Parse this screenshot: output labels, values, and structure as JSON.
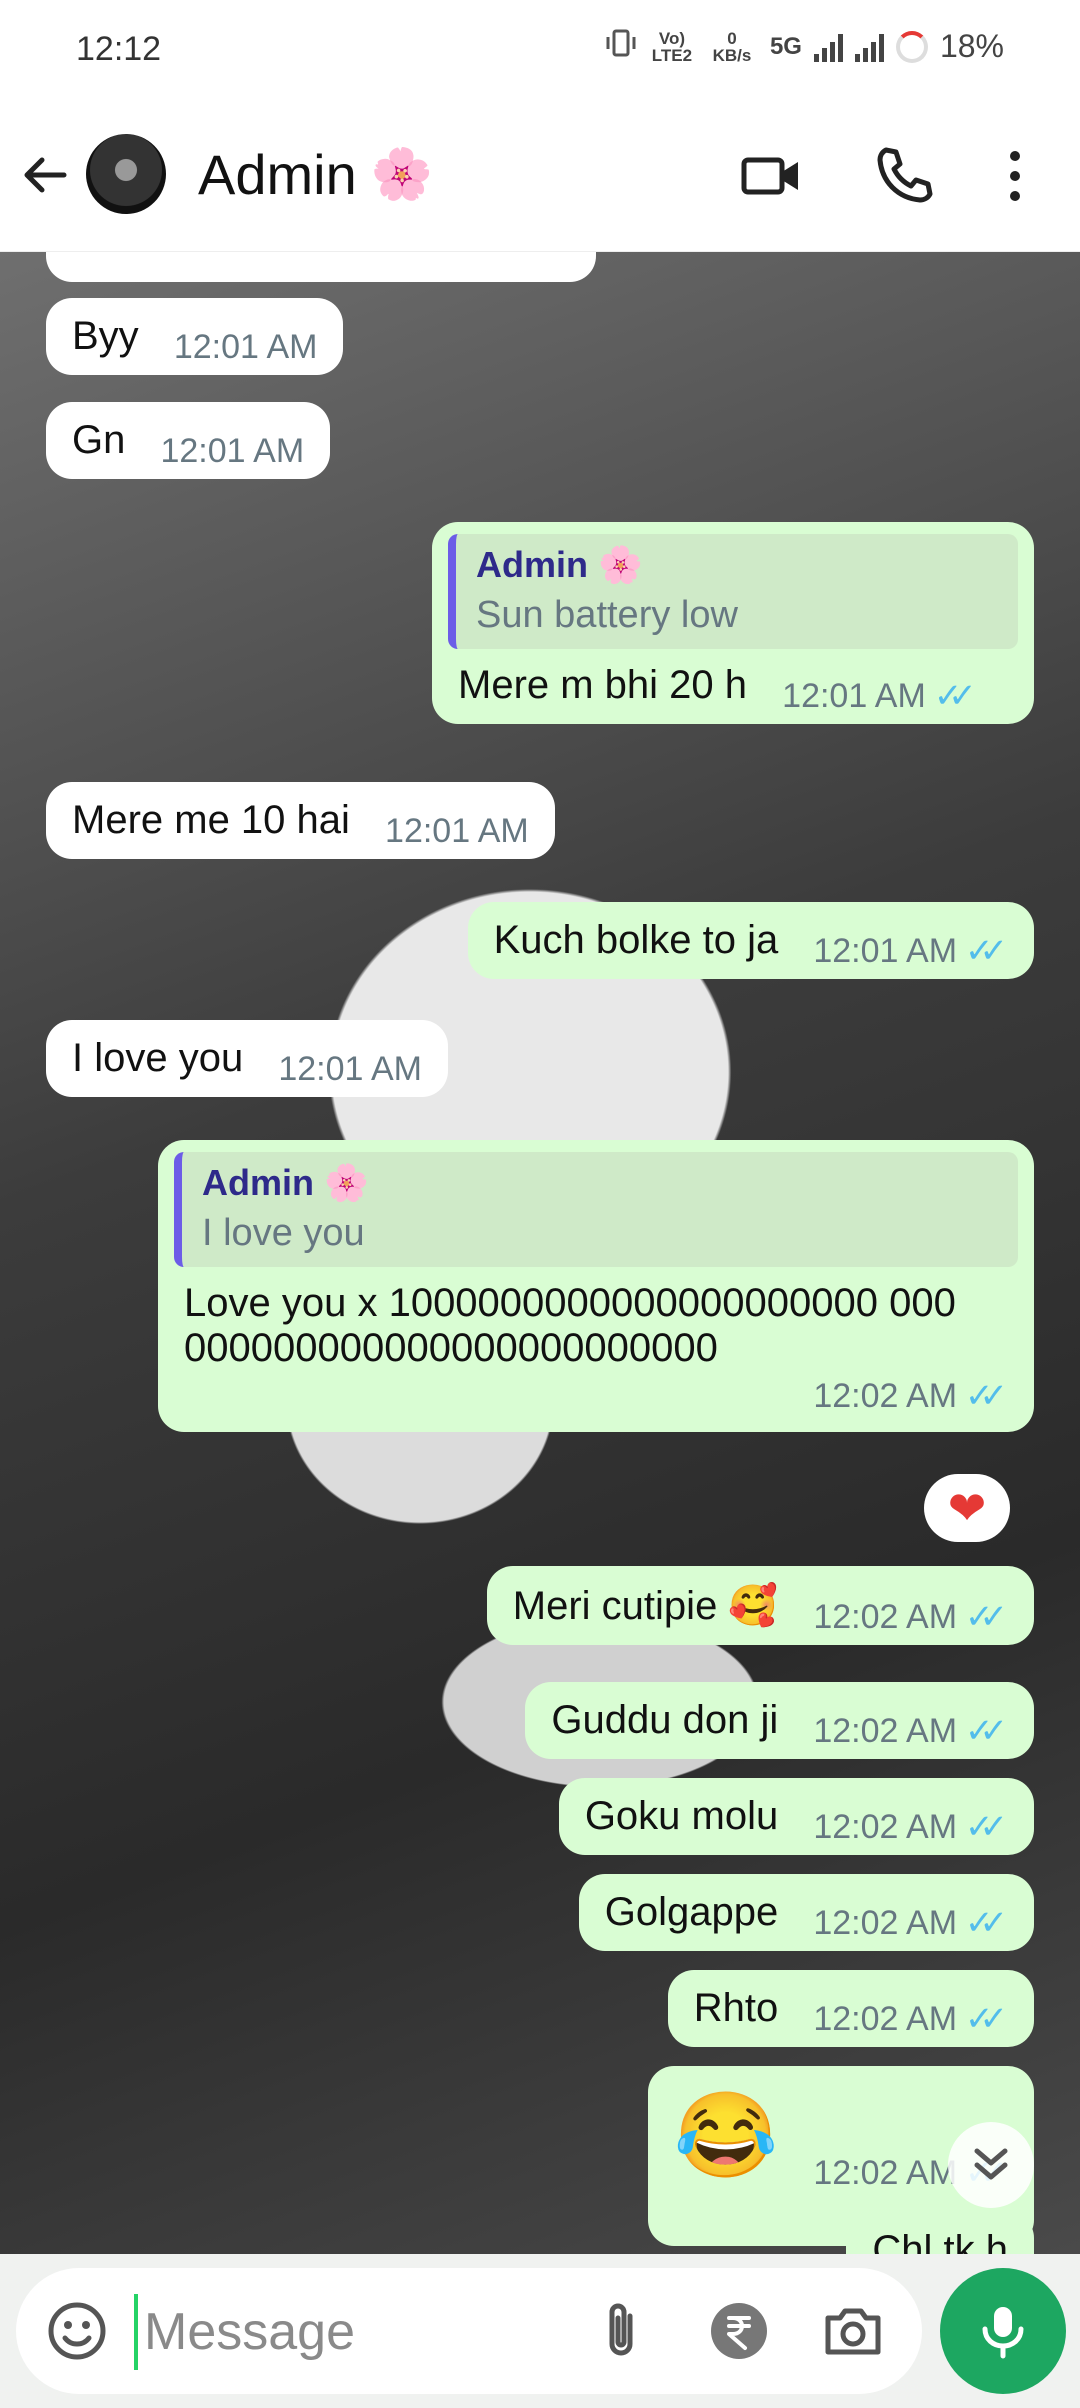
{
  "status_bar": {
    "time": "12:12",
    "volte": "Vo) LTE2",
    "network_speed": "0 KB/s",
    "network": "5G",
    "battery": "18%"
  },
  "app_bar": {
    "title": "Admin",
    "title_emoji": "🌸",
    "icons": [
      "back-arrow-icon",
      "video-call-icon",
      "phone-icon",
      "more-vert-icon"
    ]
  },
  "messages": [
    {
      "dir": "in",
      "text": "Byy",
      "time": "12:01 AM"
    },
    {
      "dir": "in",
      "text": "Gn",
      "time": "12:01 AM"
    },
    {
      "dir": "out",
      "quote_author": "Admin 🌸",
      "quote_text": "Sun battery low",
      "text": "Mere m bhi 20 h",
      "time": "12:01 AM"
    },
    {
      "dir": "in",
      "text": "Mere me 10 hai",
      "time": "12:01 AM"
    },
    {
      "dir": "out",
      "text": "Kuch bolke to ja",
      "time": "12:01 AM"
    },
    {
      "dir": "in",
      "text": "I love you",
      "time": "12:01 AM"
    },
    {
      "dir": "out",
      "quote_author": "Admin 🌸",
      "quote_text": "I love you",
      "text": "Love you x 1000000000000000000000 000000000000000000000000000",
      "time": "12:02 AM",
      "reaction": "❤"
    },
    {
      "dir": "out",
      "text": "Meri cutipie 🥰",
      "time": "12:02 AM"
    },
    {
      "dir": "out",
      "text": "Guddu don ji",
      "time": "12:02 AM"
    },
    {
      "dir": "out",
      "text": "Goku molu",
      "time": "12:02 AM"
    },
    {
      "dir": "out",
      "text": "Golgappe",
      "time": "12:02 AM"
    },
    {
      "dir": "out",
      "text": "Rhto",
      "time": "12:02 AM"
    },
    {
      "dir": "out",
      "text": "😂",
      "time": "12:02 AM"
    },
    {
      "dir": "out",
      "text": "Chl tk h"
    }
  ],
  "input": {
    "placeholder": "Message",
    "icons": [
      "emoji-icon",
      "attach-icon",
      "rupee-icon",
      "camera-icon",
      "mic-icon"
    ]
  },
  "colors": {
    "outgoing_bubble": "#d9fdd3",
    "incoming_bubble": "#ffffff",
    "read_ticks": "#53bdeb",
    "accent_green": "#1da761"
  }
}
